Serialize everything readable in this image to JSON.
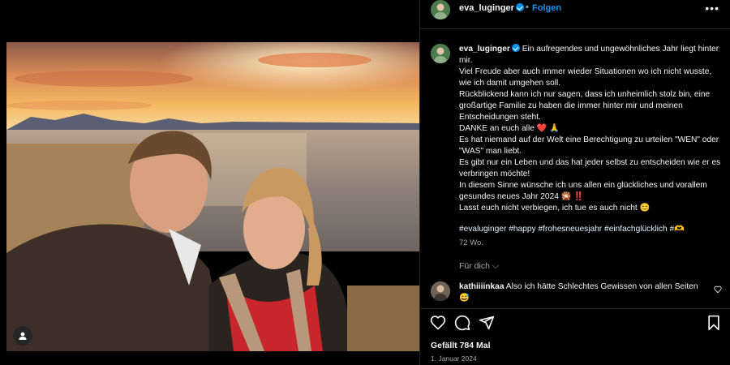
{
  "post": {
    "username": "eva_luginger",
    "follow_label": "Folgen",
    "more_icon": "more-icon",
    "accent_color": "#0095f6"
  },
  "caption": {
    "username": "eva_luginger",
    "lines": [
      "Ein aufregendes und ungewöhnliches Jahr liegt hinter mir.",
      "Viel Freude aber auch immer wieder Situationen wo ich nicht wusste, wie ich damit umgehen soll.",
      "Rückblickend kann ich nur sagen, dass ich unheimlich stolz bin, eine großartige Familie zu haben die immer hinter mir und meinen Entscheidungen steht.",
      "DANKE an euch alle ❤️ 🙏",
      "Es hat niemand auf der Welt eine Berechtigung zu urteilen \"WEN\" oder \"WAS\" man liebt.",
      "Es gibt nur ein Leben und das hat jeder selbst zu entscheiden wie er es verbringen möchte!",
      "In diesem Sinne wünsche ich uns allen ein glückliches und vorallem gesundes neues Jahr 2024 🎇 ‼️",
      "Lasst euch nicht verbiegen, ich tue es auch nicht 😊"
    ],
    "hashtags": [
      "#evaluginger",
      "#happy",
      "#frohesneuesjahr",
      "#einfachglücklich",
      "#🫶"
    ],
    "age": "72 Wo."
  },
  "for_you_label": "Für dich",
  "comment": {
    "username": "kathiiiinkaa",
    "text": "Also ich hätte Schlechtes Gewissen von allen Seiten 😅"
  },
  "stats": {
    "likes": "Gefällt 784 Mal",
    "date": "1. Januar 2024"
  }
}
